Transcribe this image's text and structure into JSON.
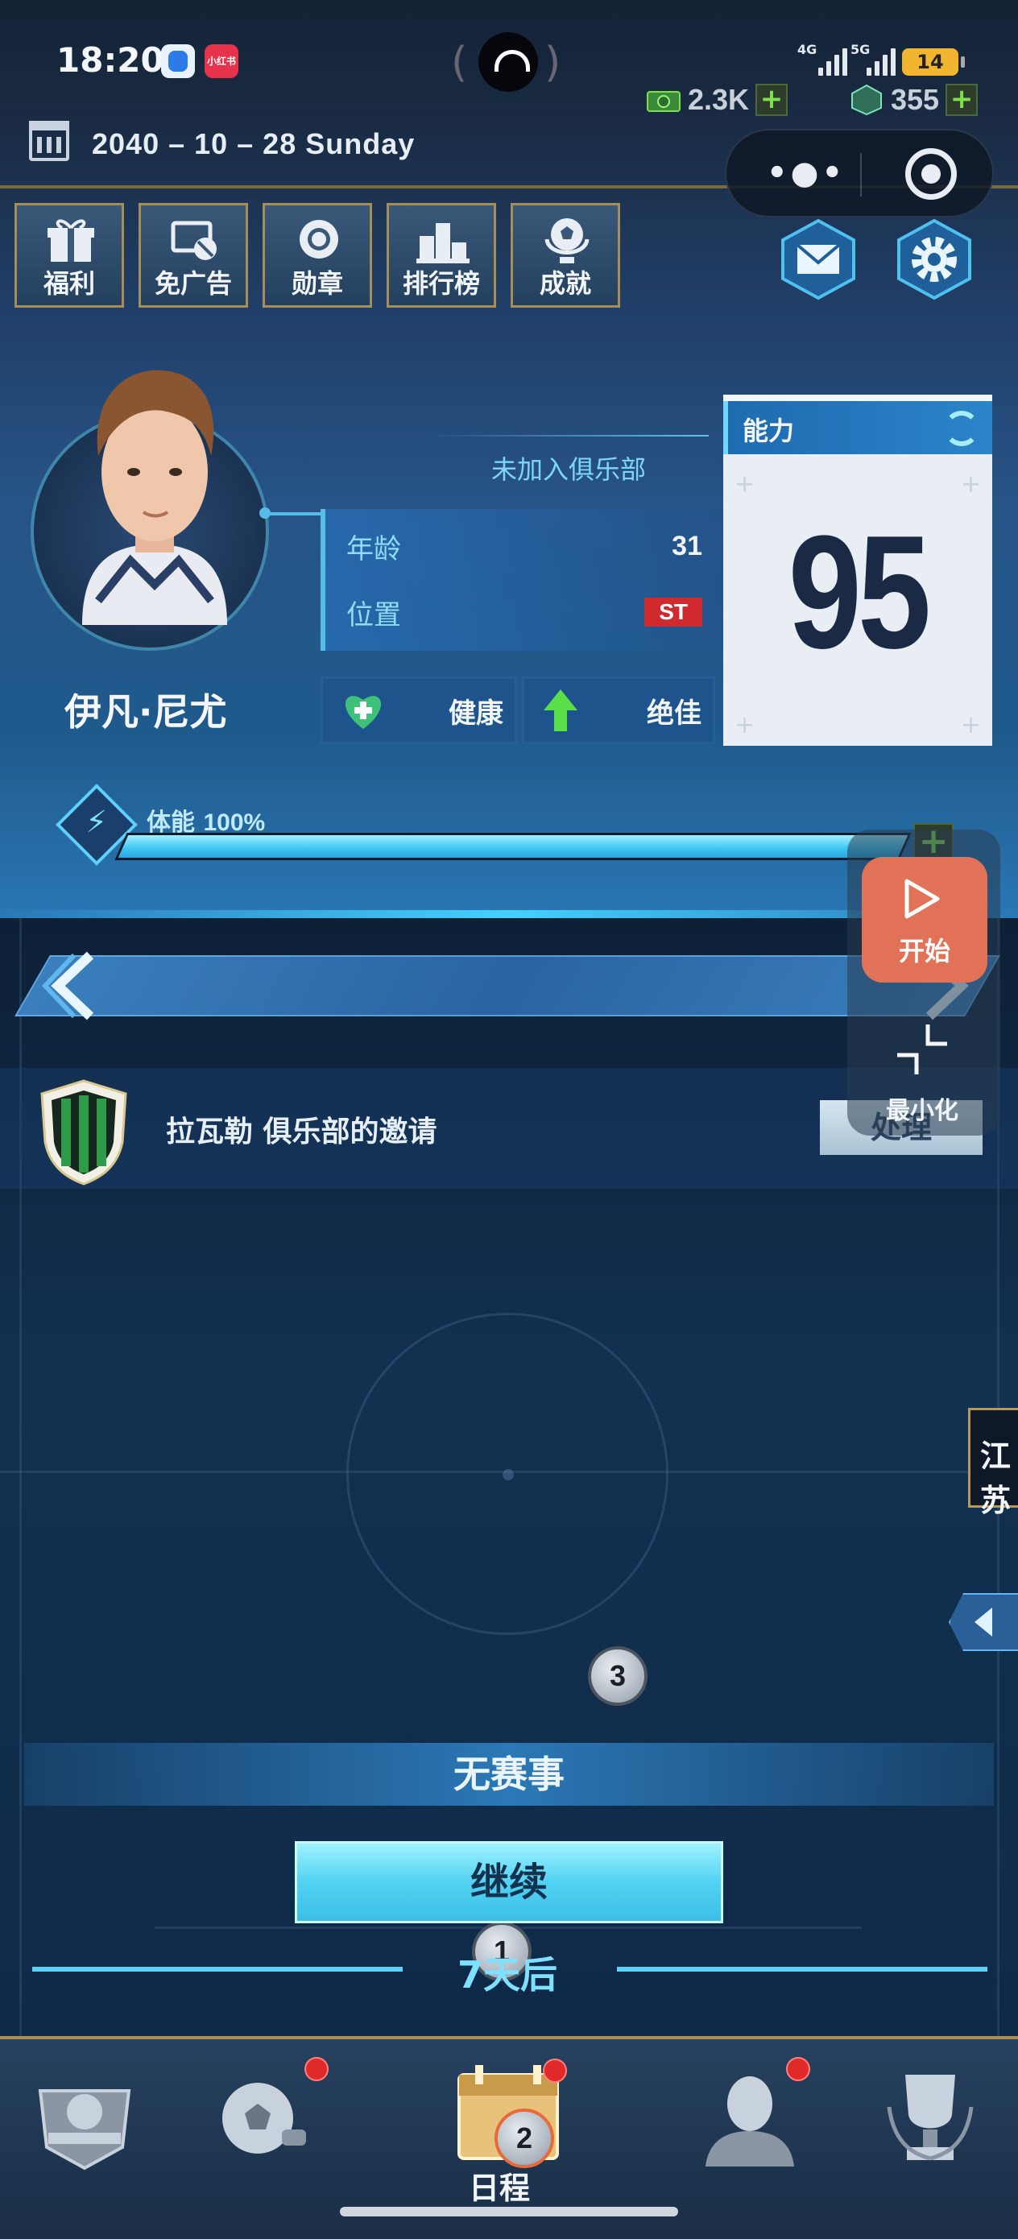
{
  "status_bar": {
    "time": "18:20",
    "app2_label": "小红书",
    "net1": "4G",
    "net2": "5G",
    "battery": "14"
  },
  "currency": {
    "cash": "2.3K",
    "gems": "355"
  },
  "date": "2040 – 10 – 28   Sunday",
  "menu": [
    {
      "label": "福利",
      "icon": "gift-icon"
    },
    {
      "label": "免广告",
      "icon": "no-ads-icon"
    },
    {
      "label": "勋章",
      "icon": "medal-icon"
    },
    {
      "label": "排行榜",
      "icon": "podium-icon"
    },
    {
      "label": "成就",
      "icon": "trophy-ball-icon"
    }
  ],
  "player": {
    "name": "伊凡·尼尤",
    "club": "未加入俱乐部",
    "age_label": "年龄",
    "age": "31",
    "position_label": "位置",
    "position": "ST",
    "health": "健康",
    "form": "绝佳",
    "ability_label": "能力",
    "ability": "95",
    "stamina_label": "体能",
    "stamina_value": "100%",
    "stamina_fraction": 1.0
  },
  "invitation": {
    "text": "拉瓦勒 俱乐部的邀请",
    "button": "处理"
  },
  "floating": {
    "start": "开始",
    "minimize": "最小化"
  },
  "side_tab": "江苏",
  "steps": [
    "3",
    "1",
    "2"
  ],
  "no_match": "无赛事",
  "continue": "继续",
  "after": "7天后",
  "bottom_nav": {
    "schedule": "日程"
  },
  "colors": {
    "accent_gold": "#a68e56",
    "accent_cyan": "#52d2f2",
    "badge_red": "#d02a2f",
    "start_orange": "#e27257"
  }
}
